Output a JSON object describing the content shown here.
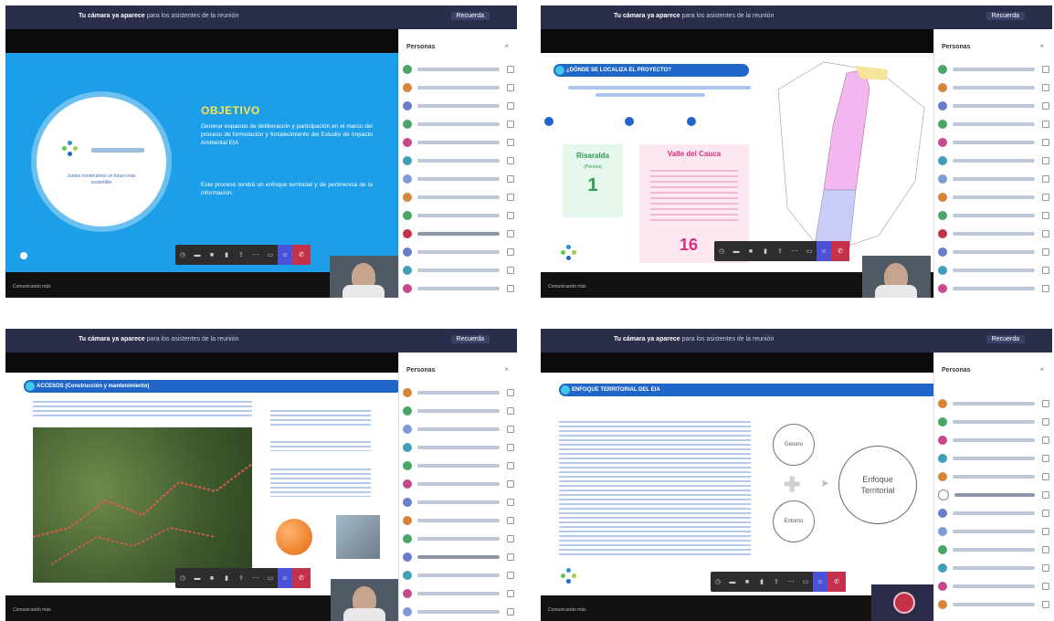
{
  "shots": [
    {
      "notice": "Tu cámara ya aparece",
      "notice_rest": " para los asistentes de la reunión",
      "dismiss": "Recuerda",
      "panel_title": "Personas",
      "close": "×",
      "slide": {
        "title": "OBJETIVO",
        "para1": "Generar espacios de deliberación y participación en el marco del proceso de formulación y fortalecimiento del Estudio de Impacto Ambiental EIA",
        "para2": "Este proceso tendrá un enfoque territorial y de pertinencia de la información.",
        "logo_caption": "Juntos construimos un futuro más sostenible"
      },
      "caption": "Comunicando más"
    },
    {
      "notice": "Tu cámara ya aparece",
      "notice_rest": " para los asistentes de la reunión",
      "dismiss": "Recuerda",
      "panel_title": "Personas",
      "close": "×",
      "slide": {
        "banner": "¿DÓNDE SE LOCALIZA EL PROYECTO?",
        "left_title": "Risaralda",
        "left_sub": "(Pereira)",
        "left_count": "1",
        "right_title": "Valle del Cauca",
        "right_count": "16"
      },
      "caption": "Comunicando más"
    },
    {
      "notice": "Tu cámara ya aparece",
      "notice_rest": " para los asistentes de la reunión",
      "dismiss": "Recuerda",
      "panel_title": "Personas",
      "close": "×",
      "slide": {
        "banner": "ACCESOS (Construcción y mantenimiento)"
      },
      "caption": "Comunicando más"
    },
    {
      "notice": "Tu cámara ya aparece",
      "notice_rest": " para los asistentes de la reunión",
      "dismiss": "Recuerda",
      "panel_title": "Personas",
      "close": "×",
      "slide": {
        "banner": "ENFOQUE TERRITORIAL DEL EIA",
        "circle1": "Género",
        "circle2": "Entorno",
        "big_circle": "Enfoque Territorial"
      },
      "caption": "Comunicando más"
    }
  ],
  "colors": {
    "slide_blue": "#1d9ee8",
    "banner_blue": "#1f66c8",
    "leave_red": "#c4314b",
    "share_purple": "#4b52d6"
  }
}
